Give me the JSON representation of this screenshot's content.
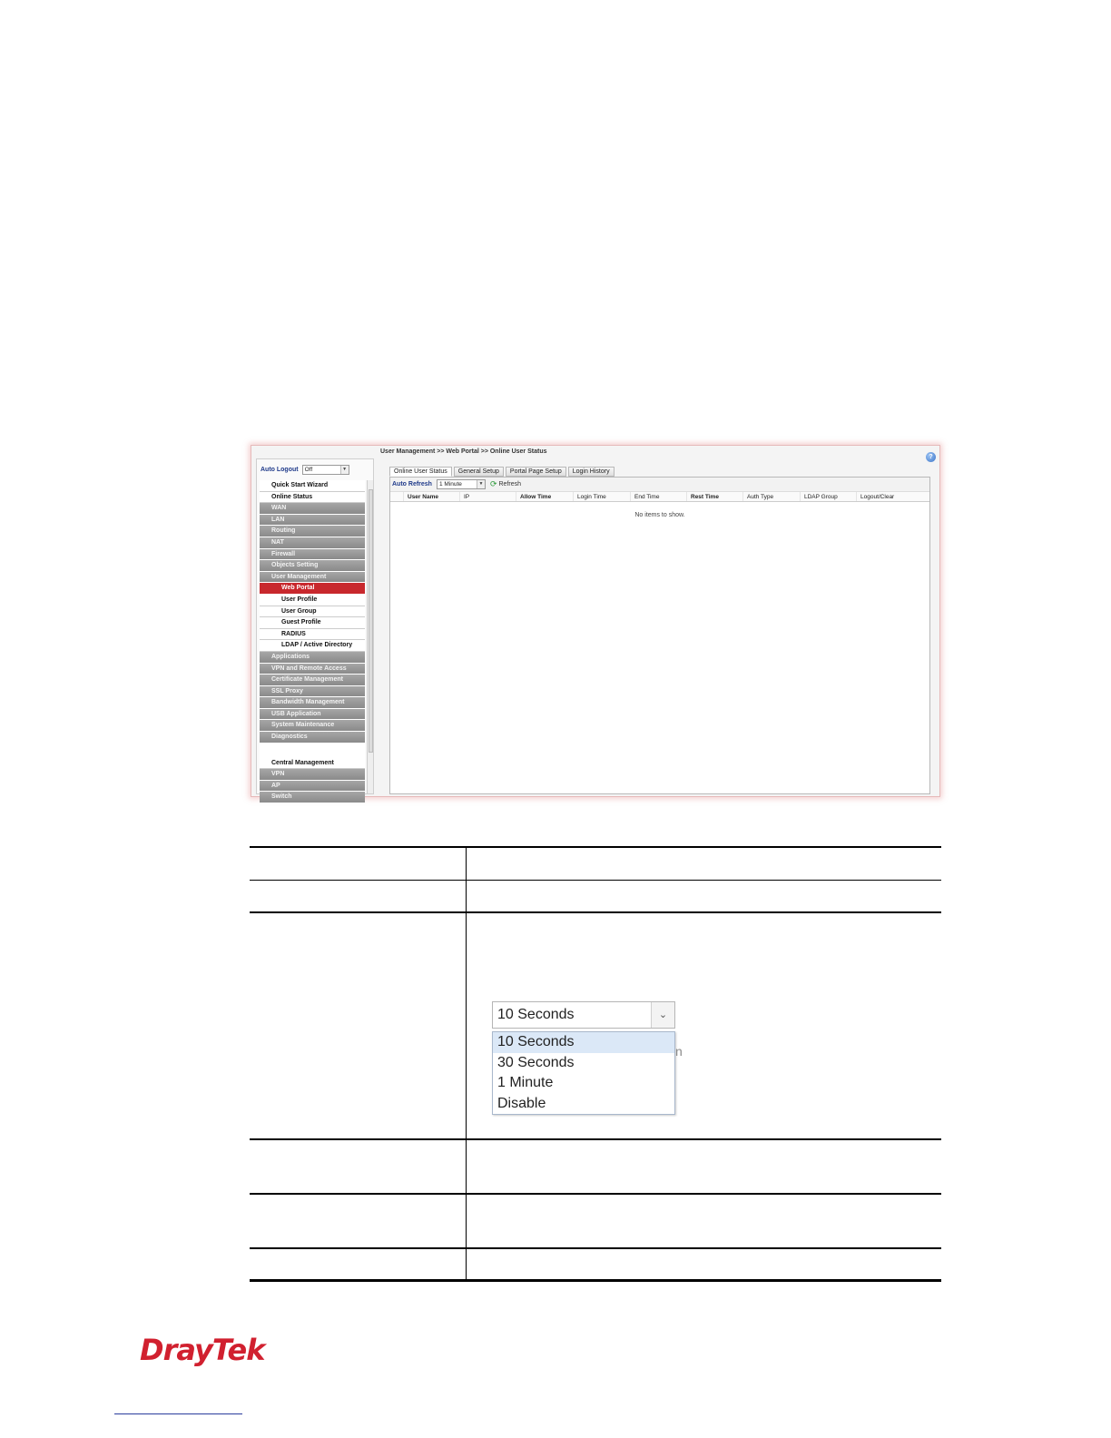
{
  "screenshot": {
    "auto_logout": {
      "label": "Auto Logout",
      "value": "Off"
    },
    "menu": [
      {
        "label": "Quick Start Wizard",
        "style": "white"
      },
      {
        "label": "Online Status",
        "style": "white"
      },
      {
        "label": "WAN",
        "style": "gray"
      },
      {
        "label": "LAN",
        "style": "gray"
      },
      {
        "label": "Routing",
        "style": "gray"
      },
      {
        "label": "NAT",
        "style": "gray"
      },
      {
        "label": "Firewall",
        "style": "gray"
      },
      {
        "label": "Objects Setting",
        "style": "gray"
      },
      {
        "label": "User Management",
        "style": "gray"
      },
      {
        "label": "Web Portal",
        "style": "active"
      },
      {
        "label": "User Profile",
        "style": "sub"
      },
      {
        "label": "User Group",
        "style": "sub"
      },
      {
        "label": "Guest Profile",
        "style": "sub"
      },
      {
        "label": "RADIUS",
        "style": "sub"
      },
      {
        "label": "LDAP / Active Directory",
        "style": "sub"
      },
      {
        "label": "Applications",
        "style": "gray"
      },
      {
        "label": "VPN and Remote Access",
        "style": "gray"
      },
      {
        "label": "Certificate Management",
        "style": "gray"
      },
      {
        "label": "SSL Proxy",
        "style": "gray"
      },
      {
        "label": "Bandwidth Management",
        "style": "gray"
      },
      {
        "label": "USB Application",
        "style": "gray"
      },
      {
        "label": "System Maintenance",
        "style": "gray"
      },
      {
        "label": "Diagnostics",
        "style": "gray"
      },
      {
        "label": "",
        "style": "spacer"
      },
      {
        "label": "Central Management",
        "style": "white"
      },
      {
        "label": "VPN",
        "style": "gray"
      },
      {
        "label": "AP",
        "style": "gray"
      },
      {
        "label": "Switch",
        "style": "gray"
      }
    ],
    "breadcrumb": "User Management >> Web Portal >> Online User Status",
    "help_icon": "help-icon",
    "tabs": [
      {
        "label": "Online User Status",
        "active": true
      },
      {
        "label": "General Setup",
        "active": false
      },
      {
        "label": "Portal Page Setup",
        "active": false
      },
      {
        "label": "Login History",
        "active": false
      }
    ],
    "toolbar": {
      "auto_refresh_label": "Auto Refresh",
      "auto_refresh_value": "1 Minute",
      "refresh_label": "Refresh"
    },
    "columns": [
      {
        "label": "User Name",
        "bold": true
      },
      {
        "label": "IP",
        "bold": false
      },
      {
        "label": "Allow Time",
        "bold": true
      },
      {
        "label": "Login Time",
        "bold": false
      },
      {
        "label": "End Time",
        "bold": false
      },
      {
        "label": "Rest Time",
        "bold": true
      },
      {
        "label": "Auth Type",
        "bold": false
      },
      {
        "label": "LDAP Group",
        "bold": false
      },
      {
        "label": "Logout/Clear",
        "bold": false
      }
    ],
    "empty_message": "No items to show."
  },
  "dropdown": {
    "selected": "10 Seconds",
    "options": [
      "10 Seconds",
      "30 Seconds",
      "1 Minute",
      "Disable"
    ],
    "highlighted_index": 0
  },
  "logo": "DrayTek"
}
